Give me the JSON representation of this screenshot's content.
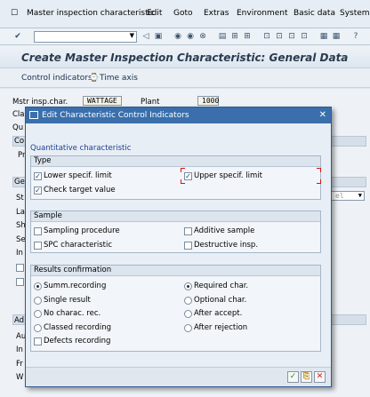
{
  "menu": {
    "items": [
      "Master inspection characteristic",
      "Edit",
      "Goto",
      "Extras",
      "Environment",
      "Basic data",
      "System"
    ]
  },
  "toolbar": {
    "command_value": ""
  },
  "header": {
    "title": "Create Master Inspection Characteristic: General Data"
  },
  "app_toolbar": {
    "control_indicators": "Control indicators",
    "time_axis": "Time axis"
  },
  "background": {
    "mstr_label": "Mstr insp.char.",
    "mstr_value": "WATTAGE",
    "plant_label": "Plant",
    "plant_value": "1000",
    "frag_cla": "Clas",
    "frag_qu": "Qu",
    "frag_co": "Co",
    "frag_pr": "Pr",
    "frag_ge": "Ge",
    "frag_st": "St",
    "frag_la": "La",
    "frag_sh": "Sh",
    "frag_se": "Se",
    "frag_in": "In",
    "frag_ad": "Ad",
    "frag_au": "Au",
    "frag_in2": "In",
    "frag_fr": "Fr",
    "frag_w": "W",
    "frag_el": "el"
  },
  "dialog": {
    "title": "Edit Characteristic Control Indicators",
    "char_type": "Quantitative characteristic",
    "type_group": {
      "label": "Type",
      "items": [
        {
          "label": "Lower specif. limit",
          "checked": true
        },
        {
          "label": "Upper specif. limit",
          "checked": true
        },
        {
          "label": "Check target value",
          "checked": true
        }
      ]
    },
    "sample_group": {
      "label": "Sample",
      "items": [
        {
          "label": "Sampling procedure",
          "checked": false
        },
        {
          "label": "Additive sample",
          "checked": false
        },
        {
          "label": "SPC characteristic",
          "checked": false
        },
        {
          "label": "Destructive insp.",
          "checked": false
        }
      ]
    },
    "results_group": {
      "label": "Results confirmation",
      "left": [
        {
          "label": "Summ.recording",
          "selected": true
        },
        {
          "label": "Single result",
          "selected": false
        },
        {
          "label": "No charac. rec.",
          "selected": false
        },
        {
          "label": "Classed recording",
          "selected": false
        }
      ],
      "right": [
        {
          "label": "Required char.",
          "selected": true
        },
        {
          "label": "Optional char.",
          "selected": false
        },
        {
          "label": "After accept.",
          "selected": false
        },
        {
          "label": "After rejection",
          "selected": false
        }
      ],
      "defects": {
        "label": "Defects recording",
        "checked": false
      }
    }
  },
  "colors": {
    "dialog_header": "#3a6fac",
    "title_text": "#2a3a4e",
    "link_blue": "#1c3f92"
  }
}
